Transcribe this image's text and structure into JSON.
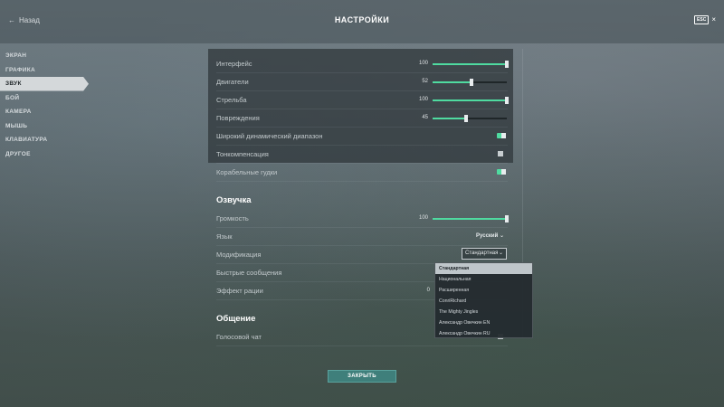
{
  "header": {
    "back_label": "Назад",
    "title": "НАСТРОЙКИ",
    "esc_label": "ESC"
  },
  "sidebar": {
    "items": [
      {
        "label": "ЭКРАН",
        "active": false
      },
      {
        "label": "ГРАФИКА",
        "active": false
      },
      {
        "label": "ЗВУК",
        "active": true
      },
      {
        "label": "БОЙ",
        "active": false
      },
      {
        "label": "КАМЕРА",
        "active": false
      },
      {
        "label": "МЫШЬ",
        "active": false
      },
      {
        "label": "КЛАВИАТУРА",
        "active": false
      },
      {
        "label": "ДРУГОЕ",
        "active": false
      }
    ]
  },
  "sound": {
    "interface": {
      "label": "Интерфейс",
      "value": 100
    },
    "engines": {
      "label": "Двигатели",
      "value": 52
    },
    "shooting": {
      "label": "Стрельба",
      "value": 100
    },
    "damage": {
      "label": "Повреждения",
      "value": 45
    },
    "wide_range": {
      "label": "Широкий динамический диапазон",
      "on": true
    },
    "tonecomp": {
      "label": "Тонкомпенсация",
      "checked": false
    },
    "horns": {
      "label": "Корабельные гудки",
      "on": true
    }
  },
  "voice": {
    "section_title": "Озвучка",
    "volume": {
      "label": "Громкость",
      "value": 100
    },
    "language": {
      "label": "Язык",
      "value": "Русский"
    },
    "mod": {
      "label": "Модификация",
      "value": "Стандартная"
    },
    "quick_msgs": {
      "label": "Быстрые сообщения"
    },
    "radio": {
      "label": "Эффект рации",
      "value": "0"
    }
  },
  "comms": {
    "section_title": "Общение",
    "voice_chat": {
      "label": "Голосовой чат"
    }
  },
  "dropdown": {
    "options": [
      "Стандартная",
      "Национальная",
      "Расширенная",
      "ConriRichard",
      "The Mighty Jingles",
      "Александр Овечкин EN",
      "Александр Овечкин RU"
    ],
    "selected": 0
  },
  "footer": {
    "close_label": "ЗАКРЫТЬ"
  },
  "colors": {
    "accent": "#4fdba0",
    "button": "#3f7f7b"
  }
}
